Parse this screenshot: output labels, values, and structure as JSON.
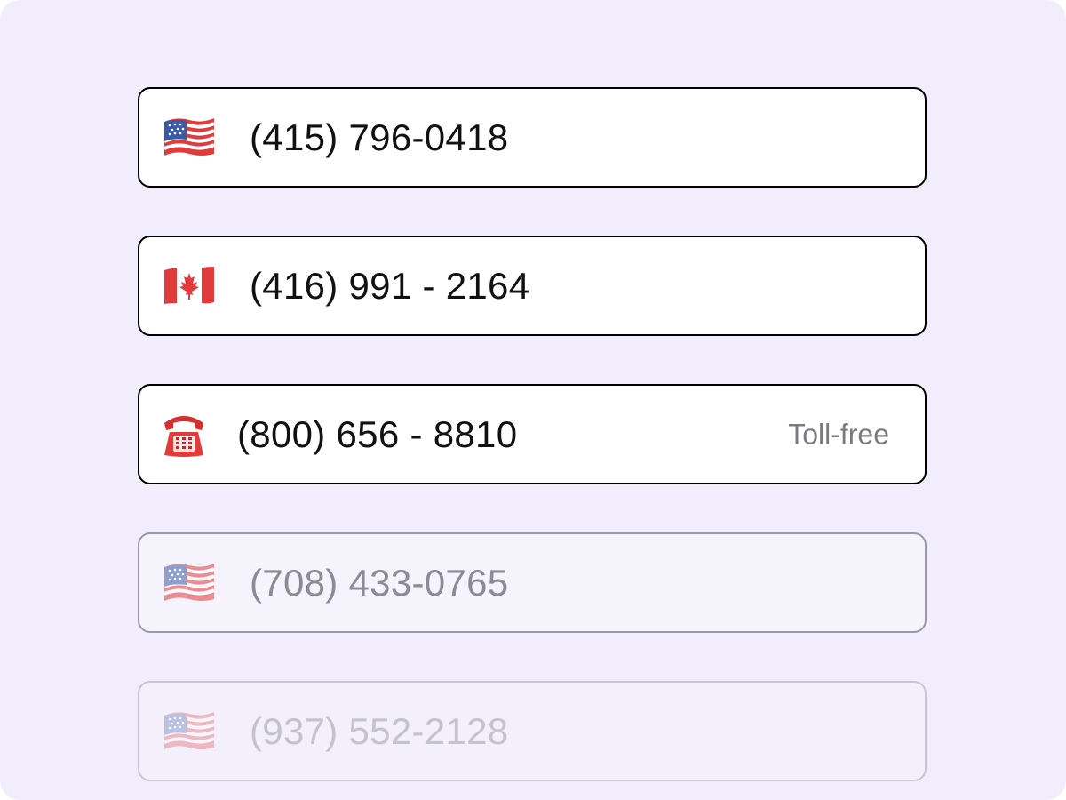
{
  "phone_numbers": [
    {
      "flag_icon": "us-flag-icon",
      "number": "(415) 796-0418",
      "tag": ""
    },
    {
      "flag_icon": "canada-flag-icon",
      "number": "(416) 991 - 2164",
      "tag": ""
    },
    {
      "flag_icon": "telephone-icon",
      "number": "(800) 656 - 8810",
      "tag": "Toll-free"
    },
    {
      "flag_icon": "us-flag-icon",
      "number": "(708) 433-0765",
      "tag": ""
    },
    {
      "flag_icon": "us-flag-icon",
      "number": "(937) 552-2128",
      "tag": ""
    }
  ],
  "colors": {
    "background": "#f1edfd",
    "field_border": "#000000",
    "text": "#111111",
    "tag_text": "#7a7a80"
  }
}
